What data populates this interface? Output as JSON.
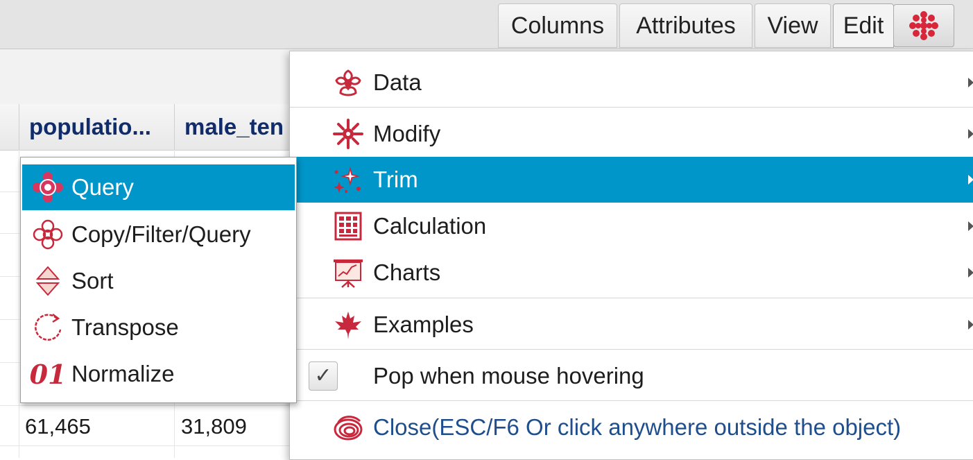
{
  "toolbar": {
    "tabs": [
      {
        "label": "Columns"
      },
      {
        "label": "Attributes"
      },
      {
        "label": "View"
      },
      {
        "label": "Edit"
      }
    ],
    "icon_button": "flower-icon"
  },
  "table": {
    "headers": [
      "populatio...",
      "male_ten"
    ],
    "last_row": [
      "61,465",
      "31,809"
    ]
  },
  "main_menu": {
    "items": [
      {
        "label": "Data",
        "icon": "data-flower-icon",
        "has_submenu": true
      },
      {
        "label": "Modify",
        "icon": "modify-flower-icon",
        "has_submenu": true
      },
      {
        "label": "Trim",
        "icon": "sparkle-icon",
        "has_submenu": true,
        "selected": true
      },
      {
        "label": "Calculation",
        "icon": "abacus-icon",
        "has_submenu": true
      },
      {
        "label": "Charts",
        "icon": "presentation-chart-icon",
        "has_submenu": true
      },
      {
        "label": "Examples",
        "icon": "maple-leaf-icon",
        "has_submenu": true
      }
    ],
    "pop_hover": {
      "label": "Pop when mouse hovering",
      "checked": true,
      "check_glyph": "✓"
    },
    "close": {
      "label": "Close(ESC/F6 Or click anywhere outside the object)",
      "icon": "close-spiral-icon"
    }
  },
  "sub_menu": {
    "items": [
      {
        "label": "Query",
        "icon": "query-ornament-icon",
        "selected": true
      },
      {
        "label": "Copy/Filter/Query",
        "icon": "flower-outline-icon"
      },
      {
        "label": "Sort",
        "icon": "sort-icon"
      },
      {
        "label": "Transpose",
        "icon": "transpose-icon"
      },
      {
        "label": "Normalize",
        "icon": "normalize-icon",
        "glyph": "01"
      }
    ]
  },
  "colors": {
    "accent": "#0096c9",
    "icon_red": "#c8283c",
    "header_text": "#102c6a",
    "close_text": "#1f4e8c"
  }
}
